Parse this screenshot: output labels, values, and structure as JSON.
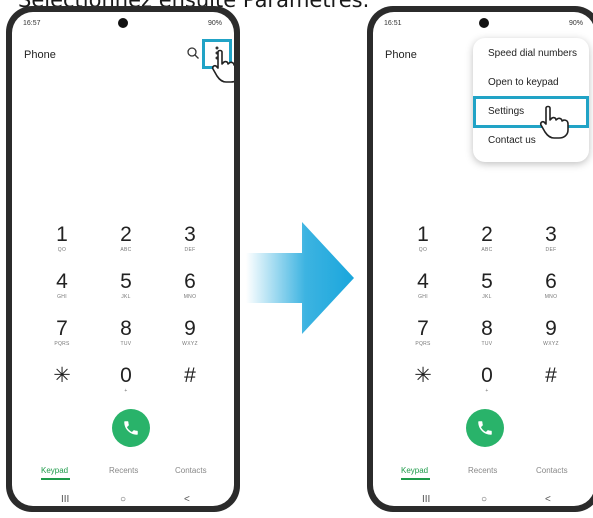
{
  "caption": "Sélectionnez ensuite Paramètres.",
  "left_phone": {
    "status_time": "16:57",
    "status_right": "90%",
    "title": "Phone"
  },
  "right_phone": {
    "status_time": "16:51",
    "status_right": "90%",
    "title": "Phone",
    "menu": [
      "Speed dial numbers",
      "Open to keypad",
      "Settings",
      "Contact us"
    ],
    "highlighted_menu_item": "Settings"
  },
  "keypad": [
    {
      "digit": "1",
      "letters": "QO"
    },
    {
      "digit": "2",
      "letters": "ABC"
    },
    {
      "digit": "3",
      "letters": "DEF"
    },
    {
      "digit": "4",
      "letters": "GHI"
    },
    {
      "digit": "5",
      "letters": "JKL"
    },
    {
      "digit": "6",
      "letters": "MNO"
    },
    {
      "digit": "7",
      "letters": "PQRS"
    },
    {
      "digit": "8",
      "letters": "TUV"
    },
    {
      "digit": "9",
      "letters": "WXYZ"
    },
    {
      "digit": "✳",
      "letters": ""
    },
    {
      "digit": "0",
      "letters": "+"
    },
    {
      "digit": "#",
      "letters": ""
    }
  ],
  "tabs": [
    "Keypad",
    "Recents",
    "Contacts"
  ],
  "active_tab": "Keypad",
  "navbar": {
    "recents": "III",
    "home": "○",
    "back": "<"
  },
  "colors": {
    "highlight": "#21a3c6",
    "accent_green": "#1e9b4a",
    "call_button": "#29b36a",
    "arrow": "#1aa6dc"
  },
  "icons": [
    "search-icon",
    "more-vert-icon",
    "phone-icon",
    "hand-pointer-icon",
    "arrow-right-icon"
  ]
}
